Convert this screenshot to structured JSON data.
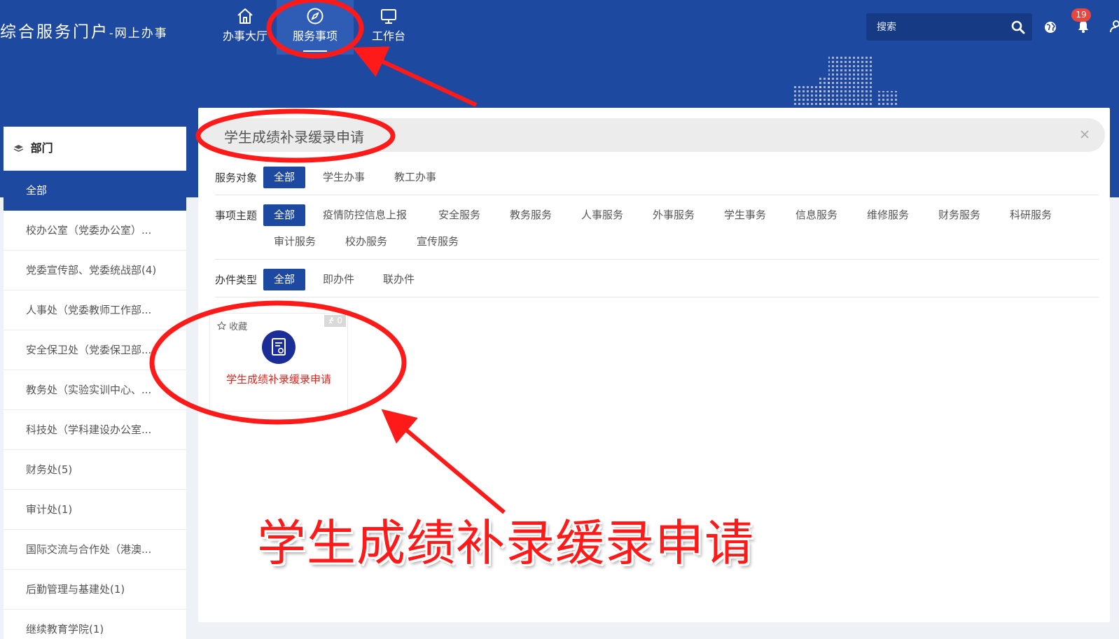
{
  "header": {
    "brand": {
      "title": "综合服务门户",
      "subtitle": "-网上办事"
    },
    "nav": [
      {
        "label": "办事大厅",
        "icon": "home-icon"
      },
      {
        "label": "服务事项",
        "icon": "compass-icon",
        "active": true
      },
      {
        "label": "工作台",
        "icon": "monitor-icon"
      }
    ],
    "search": {
      "placeholder": "搜索"
    },
    "notifications": {
      "count": "19"
    }
  },
  "sidebar": {
    "title": "部门",
    "items": [
      {
        "label": "全部",
        "active": true
      },
      {
        "label": "校办公室（党委办公室）..."
      },
      {
        "label": "党委宣传部、党委统战部(4)"
      },
      {
        "label": "人事处（党委教师工作部..."
      },
      {
        "label": "安全保卫处（党委保卫部..."
      },
      {
        "label": "教务处（实验实训中心、..."
      },
      {
        "label": "科技处（学科建设办公室..."
      },
      {
        "label": "财务处(5)"
      },
      {
        "label": "审计处(1)"
      },
      {
        "label": "国际交流与合作处（港澳..."
      },
      {
        "label": "后勤管理与基建处(1)"
      },
      {
        "label": "继续教育学院(1)"
      }
    ]
  },
  "main": {
    "search_value": "学生成绩补录缓录申请",
    "filters": {
      "target": {
        "label": "服务对象",
        "options": [
          "全部",
          "学生办事",
          "教工办事"
        ]
      },
      "theme": {
        "label": "事项主题",
        "options_row1": [
          "全部",
          "疫情防控信息上报",
          "安全服务",
          "教务服务",
          "人事服务",
          "外事服务",
          "学生事务",
          "信息服务",
          "维修服务",
          "财务服务",
          "科研服务"
        ],
        "options_row2": [
          "审计服务",
          "校办服务",
          "宣传服务"
        ]
      },
      "type": {
        "label": "办件类型",
        "options": [
          "全部",
          "即办件",
          "联办件"
        ]
      }
    },
    "card": {
      "favorite_label": "收藏",
      "count": "0",
      "title": "学生成绩补录缓录申请"
    }
  },
  "annotation": {
    "text": "学生成绩补录缓录申请",
    "color": "#ff1a1a"
  },
  "colors": {
    "primary": "#1e49a0",
    "highlight": "#e2231a"
  }
}
